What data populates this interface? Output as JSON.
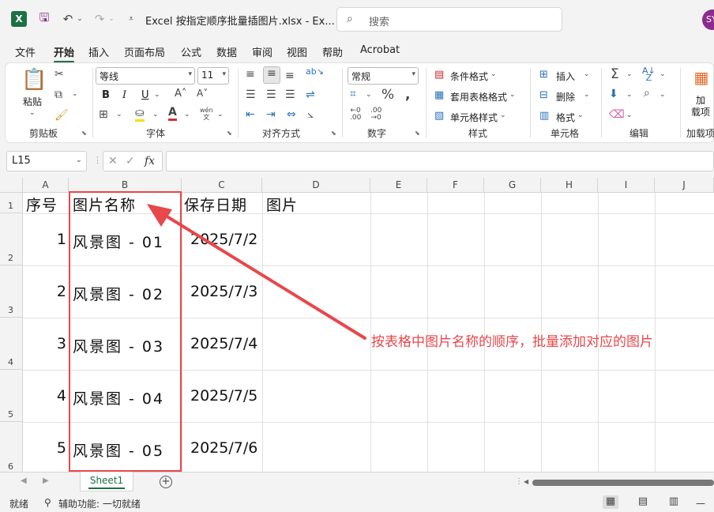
{
  "titlebar": {
    "doc_title": "Excel 按指定顺序批量插图片.xlsx  -  Ex...",
    "search_placeholder": "搜索",
    "avatar": "SY"
  },
  "menu": [
    "文件",
    "开始",
    "插入",
    "页面布局",
    "公式",
    "数据",
    "审阅",
    "视图",
    "帮助",
    "Acrobat"
  ],
  "ribbon": {
    "clipboard": {
      "paste": "粘贴",
      "label": "剪贴板"
    },
    "font": {
      "name": "等线",
      "size": "11",
      "bold": "B",
      "italic": "I",
      "underline": "U",
      "label": "字体",
      "wen": "wén\n文"
    },
    "alignment": {
      "label": "对齐方式"
    },
    "number": {
      "format": "常规",
      "label": "数字"
    },
    "styles": {
      "cond": "条件格式",
      "table": "套用表格格式",
      "cell": "单元格样式",
      "label": "样式"
    },
    "cells": {
      "insert": "插入",
      "delete": "删除",
      "format": "格式",
      "label": "单元格"
    },
    "editing": {
      "label": "编辑"
    },
    "addins": {
      "button": "加\n载项",
      "label": "加载项"
    }
  },
  "formula_bar": {
    "name_box": "L15",
    "fx": "fx",
    "content": ""
  },
  "columns": [
    "A",
    "B",
    "C",
    "D",
    "E",
    "F",
    "G",
    "H",
    "I",
    "J"
  ],
  "rows": [
    "1",
    "2",
    "3",
    "4",
    "5",
    "6"
  ],
  "sheet": {
    "headers": [
      "序号",
      "图片名称",
      "保存日期",
      "图片"
    ],
    "data": [
      {
        "no": "1",
        "name": "风景图 - 01",
        "date": "2025/7/2"
      },
      {
        "no": "2",
        "name": "风景图 - 02",
        "date": "2025/7/3"
      },
      {
        "no": "3",
        "name": "风景图 - 03",
        "date": "2025/7/4"
      },
      {
        "no": "4",
        "name": "风景图 - 04",
        "date": "2025/7/5"
      },
      {
        "no": "5",
        "name": "风景图 - 05",
        "date": "2025/7/6"
      }
    ]
  },
  "annotation": "按表格中图片名称的顺序，批量添加对应的图片",
  "tabs": {
    "sheet1": "Sheet1"
  },
  "status": {
    "ready": "就绪",
    "accessibility": "辅助功能: 一切就绪"
  },
  "colors": {
    "accent": "#1d7044",
    "annotation_red": "#e8474b",
    "avatar": "#8c2b8e"
  }
}
